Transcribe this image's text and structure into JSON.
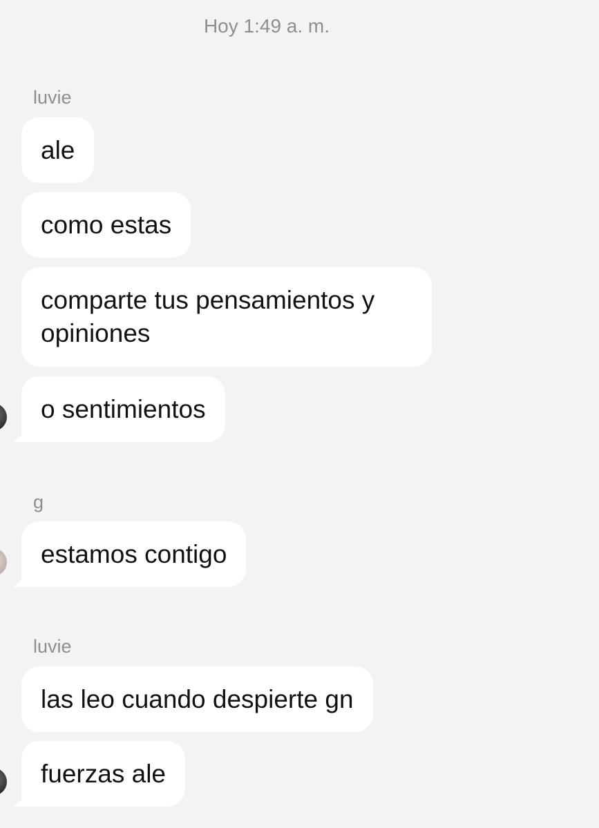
{
  "chat": {
    "timestamp": "Hoy 1:49 a. m.",
    "groups": [
      {
        "sender": "luvie",
        "messages": [
          "ale",
          "como estas",
          "comparte tus pensamientos y opiniones",
          "o sentimientos"
        ]
      },
      {
        "sender": "g",
        "messages": [
          "estamos contigo"
        ]
      },
      {
        "sender": "luvie",
        "messages": [
          "las leo cuando despierte gn",
          "fuerzas ale"
        ]
      }
    ]
  }
}
